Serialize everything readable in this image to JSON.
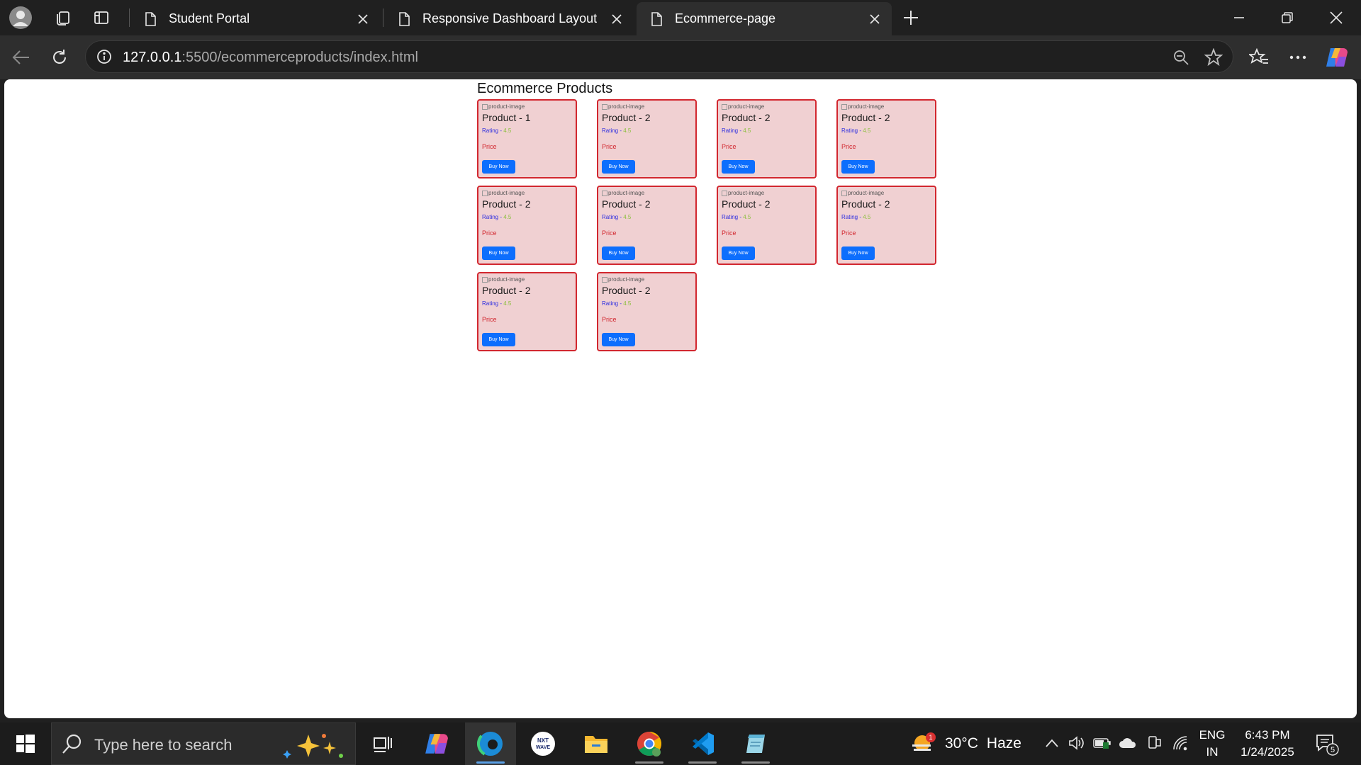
{
  "browser": {
    "tabs": [
      {
        "title": "Student Portal",
        "active": false
      },
      {
        "title": "Responsive Dashboard Layout",
        "active": false
      },
      {
        "title": "Ecommerce-page",
        "active": true
      }
    ],
    "address": {
      "host": "127.0.0.1",
      "rest": ":5500/ecommerceproducts/index.html"
    },
    "icons": [
      "profile-icon",
      "workspaces-icon",
      "vertical-tabs-icon",
      "page-icon",
      "close-icon",
      "new-tab-icon",
      "minimize-icon",
      "restore-icon",
      "window-close-icon",
      "back-icon",
      "refresh-icon",
      "site-info-icon",
      "zoom-out-icon",
      "favorite-star-icon",
      "favorites-icon",
      "more-icon",
      "copilot-icon"
    ]
  },
  "page": {
    "title": "Ecommerce Products",
    "products": [
      {
        "name": "Product - 1",
        "img_alt": "product-image",
        "rating_label": "Rating - ",
        "rating_value": "4.5",
        "price": "Price",
        "button": "Buy Now"
      },
      {
        "name": "Product - 2",
        "img_alt": "product-image",
        "rating_label": "Rating - ",
        "rating_value": "4.5",
        "price": "Price",
        "button": "Buy Now"
      },
      {
        "name": "Product - 2",
        "img_alt": "product-image",
        "rating_label": "Rating - ",
        "rating_value": "4.5",
        "price": "Price",
        "button": "Buy Now"
      },
      {
        "name": "Product - 2",
        "img_alt": "product-image",
        "rating_label": "Rating - ",
        "rating_value": "4.5",
        "price": "Price",
        "button": "Buy Now"
      },
      {
        "name": "Product - 2",
        "img_alt": "product-image",
        "rating_label": "Rating - ",
        "rating_value": "4.5",
        "price": "Price",
        "button": "Buy Now"
      },
      {
        "name": "Product - 2",
        "img_alt": "product-image",
        "rating_label": "Rating - ",
        "rating_value": "4.5",
        "price": "Price",
        "button": "Buy Now"
      },
      {
        "name": "Product - 2",
        "img_alt": "product-image",
        "rating_label": "Rating - ",
        "rating_value": "4.5",
        "price": "Price",
        "button": "Buy Now"
      },
      {
        "name": "Product - 2",
        "img_alt": "product-image",
        "rating_label": "Rating - ",
        "rating_value": "4.5",
        "price": "Price",
        "button": "Buy Now"
      },
      {
        "name": "Product - 2",
        "img_alt": "product-image",
        "rating_label": "Rating - ",
        "rating_value": "4.5",
        "price": "Price",
        "button": "Buy Now"
      },
      {
        "name": "Product - 2",
        "img_alt": "product-image",
        "rating_label": "Rating - ",
        "rating_value": "4.5",
        "price": "Price",
        "button": "Buy Now"
      }
    ],
    "colors": {
      "card_bg": "#f0d0d2",
      "card_border": "#d2272f",
      "button_bg": "#0d6efd",
      "rating_label": "#2d2de0",
      "rating_value": "#8cbf3f",
      "price": "#d2272f"
    }
  },
  "taskbar": {
    "search_placeholder": "Type here to search",
    "weather": {
      "temp": "30°C",
      "condition": "Haze",
      "badge": "1"
    },
    "lang": {
      "line1": "ENG",
      "line2": "IN"
    },
    "clock": {
      "time": "6:43 PM",
      "date": "1/24/2025"
    },
    "notifications": "5",
    "apps": [
      "task-view-icon",
      "copilot-app-icon",
      "edge-icon",
      "nxtwave-icon",
      "file-explorer-icon",
      "chrome-icon",
      "vscode-icon",
      "notepad-icon"
    ]
  }
}
